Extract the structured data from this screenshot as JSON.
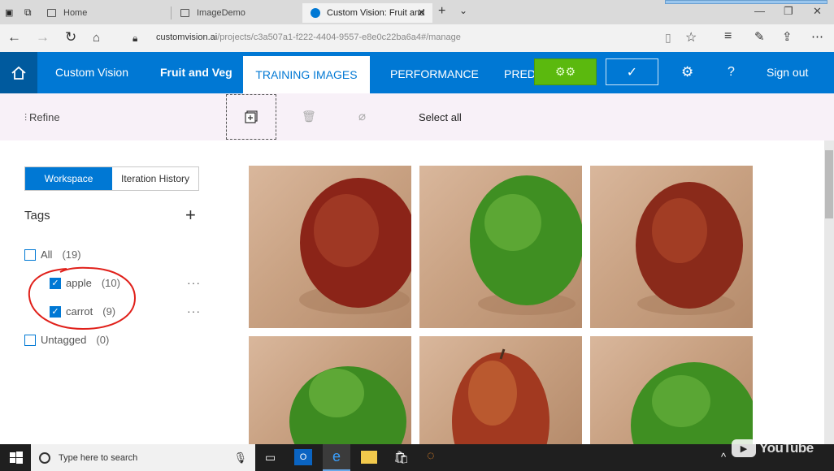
{
  "browser": {
    "tabs": [
      {
        "label": "Home"
      },
      {
        "label": "ImageDemo"
      },
      {
        "label": "Custom Vision: Fruit and"
      }
    ],
    "url_host": "customvision.ai",
    "url_path": "/projects/c3a507a1-f222-4404-9557-e8e0c22ba6a4#/manage"
  },
  "header": {
    "brand": "Custom Vision",
    "project": "Fruit and Veg",
    "tabs": [
      "TRAINING IMAGES",
      "PERFORMANCE",
      "PREDI"
    ],
    "sign_out": "Sign out",
    "help": "?"
  },
  "toolbar": {
    "refine": "Refine",
    "select_all": "Select all"
  },
  "sidebar": {
    "workspace": "Workspace",
    "iteration_history": "Iteration History",
    "tags_title": "Tags",
    "rows": [
      {
        "label": "All",
        "count": "(19)",
        "checked": false
      },
      {
        "label": "apple",
        "count": "(10)",
        "checked": true
      },
      {
        "label": "carrot",
        "count": "(9)",
        "checked": true
      },
      {
        "label": "Untagged",
        "count": "(0)",
        "checked": false
      }
    ],
    "more": "···"
  },
  "taskbar": {
    "search_placeholder": "Type here to search"
  },
  "overlay": {
    "youtube": "YouTube"
  },
  "colors": {
    "brand_blue": "#0078d4",
    "train_green": "#5bb90e",
    "annotation_red": "#e0201a"
  }
}
